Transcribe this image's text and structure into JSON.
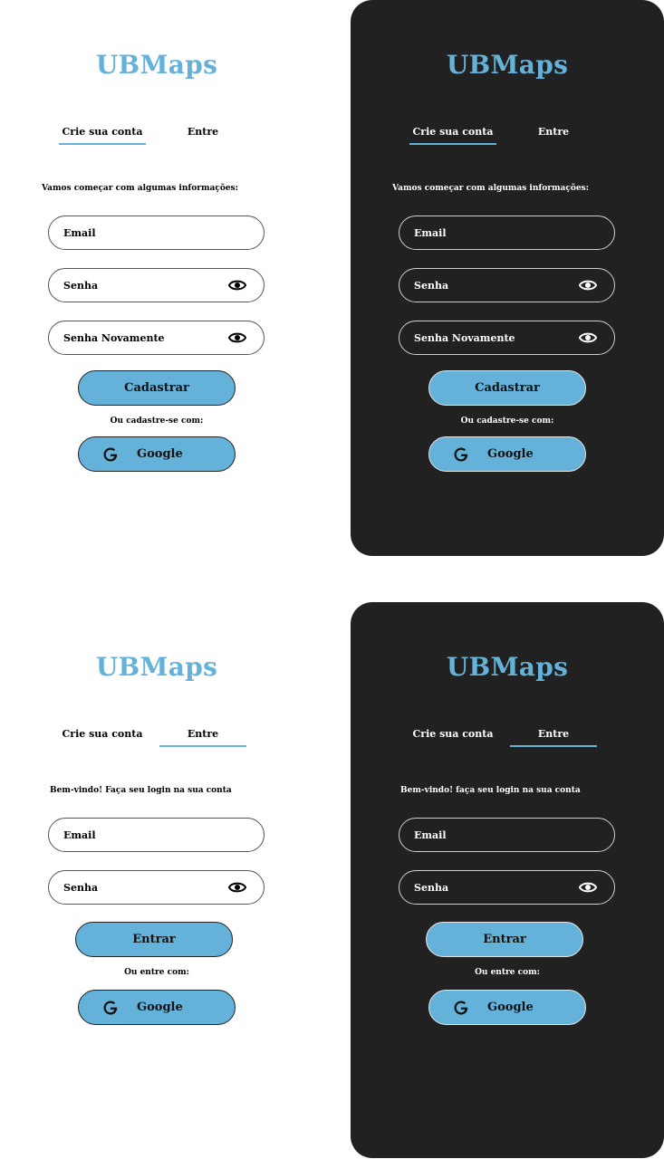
{
  "app_name": "UBMaps",
  "tabs": {
    "signup": "Crie sua conta",
    "login": "Entre"
  },
  "signup": {
    "intro": "Vamos começar com algumas informações:",
    "email_label": "Email",
    "password_label": "Senha",
    "password_repeat_label": "Senha Novamente",
    "submit_label": "Cadastrar",
    "or_text": "Ou cadastre-se com:",
    "google_label": "Google"
  },
  "login_light": {
    "intro": "Bem-vindo! Faça seu login na sua conta"
  },
  "login_dark": {
    "intro": "Bem-vindo! faça seu login na sua conta"
  },
  "login": {
    "email_label": "Email",
    "password_label": "Senha",
    "submit_label": "Entrar",
    "or_text": "Ou entre com:",
    "google_label": "Google"
  },
  "colors": {
    "accent": "#64b2d9",
    "dark_bg": "#212121",
    "light_bg": "#ffffff"
  },
  "icons": {
    "eye": "eye-icon",
    "google": "google-icon"
  }
}
